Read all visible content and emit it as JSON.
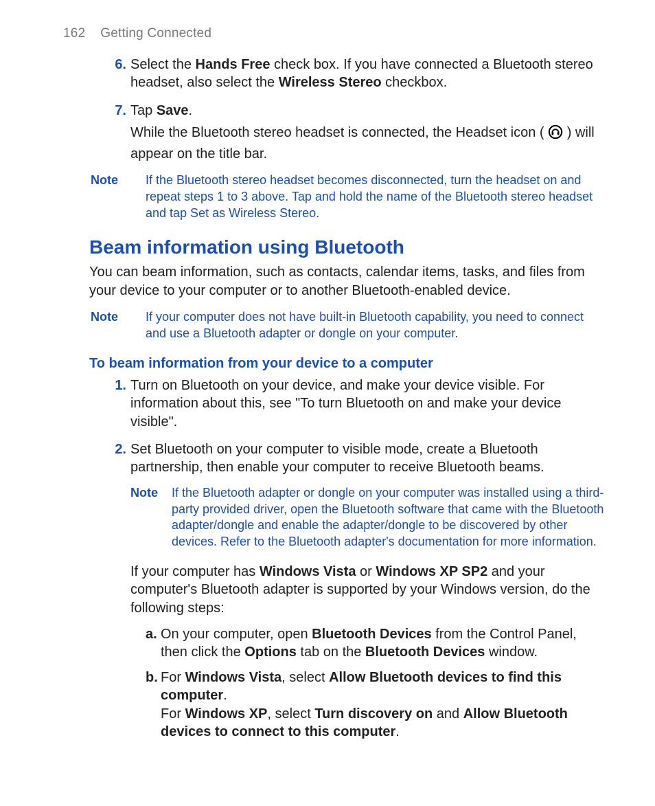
{
  "header": {
    "page_number": "162",
    "section": "Getting Connected"
  },
  "steps_top": {
    "s6": {
      "num": "6.",
      "t1": "Select the ",
      "b1": "Hands Free",
      "t2": " check box. If you have connected a Bluetooth stereo headset, also select the ",
      "b2": "Wireless Stereo",
      "t3": " checkbox."
    },
    "s7": {
      "num": "7.",
      "t1": "Tap ",
      "b1": "Save",
      "t2": ".",
      "line2a": "While the Bluetooth stereo headset is connected, the Headset icon ( ",
      "line2b": " ) will appear on the title bar."
    }
  },
  "note1": {
    "label": "Note",
    "text": "If the Bluetooth stereo headset becomes disconnected, turn the headset on and repeat steps 1 to 3 above. Tap and hold the name of the Bluetooth stereo headset and tap Set as Wireless Stereo."
  },
  "section": {
    "heading": "Beam information using Bluetooth",
    "intro": "You can beam information, such as contacts, calendar items, tasks, and files from your device to your computer or to another Bluetooth-enabled device."
  },
  "note2": {
    "label": "Note",
    "text": "If your computer does not have built-in Bluetooth capability, you need to connect and use a Bluetooth adapter or dongle on your computer."
  },
  "subheading": "To beam information from your device to a computer",
  "beam_steps": {
    "s1": {
      "num": "1.",
      "text": "Turn on Bluetooth on your device, and make your device visible. For information about this, see \"To turn Bluetooth on and make your device visible\"."
    },
    "s2": {
      "num": "2.",
      "text": "Set Bluetooth on your computer to visible mode, create a Bluetooth partnership, then enable your computer to receive Bluetooth beams.",
      "note": {
        "label": "Note",
        "text": "If the Bluetooth adapter or dongle on your computer was installed using a third-party provided driver, open the Bluetooth software that came with the Bluetooth adapter/dongle and enable the adapter/dongle to be discovered by other devices. Refer to the Bluetooth adapter's documentation for more information."
      },
      "cont": {
        "t1": "If your computer has ",
        "b1": "Windows Vista",
        "t2": " or ",
        "b2": "Windows XP SP2",
        "t3": " and your computer's Bluetooth adapter is supported by your Windows version, do the following steps:"
      },
      "sub": {
        "a": {
          "letter": "a.",
          "t1": "On your computer, open ",
          "b1": "Bluetooth Devices",
          "t2": " from the Control Panel, then click the ",
          "b2": "Options",
          "t3": " tab on the ",
          "b3": "Bluetooth Devices",
          "t4": " window."
        },
        "b": {
          "letter": "b.",
          "l1_t1": "For ",
          "l1_b1": "Windows Vista",
          "l1_t2": ", select ",
          "l1_b2": "Allow Bluetooth devices to find this computer",
          "l1_t3": ".",
          "l2_t1": "For ",
          "l2_b1": "Windows XP",
          "l2_t2": ", select ",
          "l2_b2": "Turn discovery on",
          "l2_t3": " and ",
          "l2_b3": "Allow Bluetooth devices to connect to this computer",
          "l2_t4": "."
        }
      }
    }
  }
}
